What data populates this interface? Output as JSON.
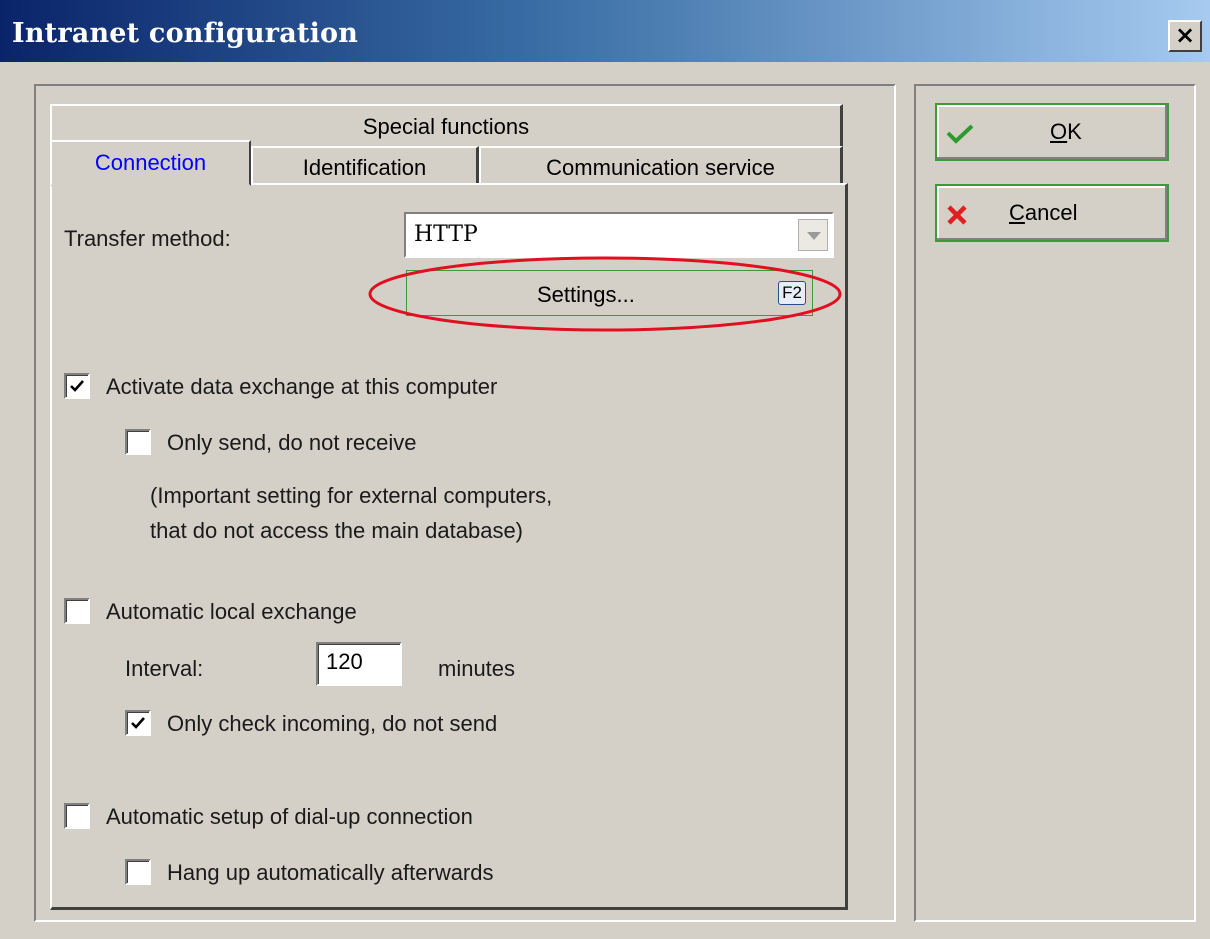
{
  "window": {
    "title": "Intranet configuration",
    "close_glyph": "×"
  },
  "tabs": {
    "row_back": [
      "Special functions"
    ],
    "row_front": [
      {
        "label": "Connection",
        "active": true
      },
      {
        "label": "Identification",
        "active": false
      },
      {
        "label": "Communication service",
        "active": false
      }
    ]
  },
  "connection": {
    "transfer_method_label": "Transfer method:",
    "transfer_method_value": "HTTP",
    "settings_button": "Settings...",
    "settings_shortcut": "F2",
    "activate_exchange": {
      "label": "Activate data exchange at this computer",
      "checked": true
    },
    "only_send": {
      "label": "Only send, do not receive",
      "checked": false
    },
    "note_line1": "(Important setting for external computers,",
    "note_line2": "that do not access the main database)",
    "auto_local": {
      "label": "Automatic local exchange",
      "checked": false
    },
    "interval_label": "Interval:",
    "interval_value": "120",
    "interval_unit": "minutes",
    "only_check_incoming": {
      "label": "Only check incoming, do not send",
      "checked": true
    },
    "auto_dialup": {
      "label": "Automatic setup of dial-up connection",
      "checked": false
    },
    "hang_up": {
      "label": "Hang up automatically afterwards",
      "checked": false
    }
  },
  "buttons": {
    "ok_label": "OK",
    "ok_mnemonic": "O",
    "ok_rest": "K",
    "cancel_label": "Cancel",
    "cancel_mnemonic": "C",
    "cancel_rest": "ancel"
  },
  "colors": {
    "face": "#d4d0c8",
    "active_tab_text": "#0000ff",
    "highlight_ellipse": "#e01020",
    "ok_icon": "#2e9a2e",
    "cancel_icon": "#e02020"
  },
  "icons": {
    "ok": "checkmark-icon",
    "cancel": "x-mark-icon"
  }
}
